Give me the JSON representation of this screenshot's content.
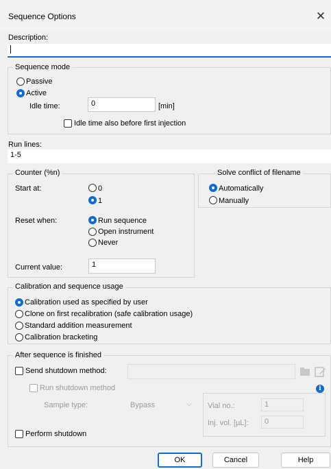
{
  "window": {
    "title": "Sequence Options"
  },
  "description": {
    "label": "Description:",
    "value": ""
  },
  "sequence_mode": {
    "legend": "Sequence mode",
    "options": [
      "Passive",
      "Active"
    ],
    "selected": "Active",
    "idle_time_label": "Idle time:",
    "idle_time_value": "0",
    "idle_time_unit": "[min]",
    "idle_before_first_label": "Idle time also before first injection",
    "idle_before_first_checked": false
  },
  "run_lines": {
    "label": "Run lines:",
    "value": "1-5"
  },
  "counter": {
    "legend": "Counter (%n)",
    "start_at_label": "Start at:",
    "start_options": [
      "0",
      "1"
    ],
    "start_selected": "1",
    "reset_when_label": "Reset when:",
    "reset_options": [
      "Run sequence",
      "Open instrument",
      "Never"
    ],
    "reset_selected": "Run sequence",
    "current_value_label": "Current value:",
    "current_value": "1"
  },
  "filename_conflict": {
    "legend": "Solve conflict of filename",
    "options": [
      "Automatically",
      "Manually"
    ],
    "selected": "Automatically"
  },
  "calibration": {
    "legend": "Calibration and sequence usage",
    "options": [
      "Calibration used as specified by user",
      "Clone on first recalibration (safe calibration usage)",
      "Standard addition measurement",
      "Calibration bracketing"
    ],
    "selected": "Calibration used as specified by user"
  },
  "after_sequence": {
    "legend": "After sequence is finished",
    "send_shutdown_label": "Send shutdown method:",
    "send_shutdown_checked": false,
    "shutdown_method_value": "",
    "run_shutdown_label": "Run shutdown method",
    "sample_type_label": "Sample type:",
    "sample_type_value": "Bypass",
    "vial_no_label": "Vial no.:",
    "vial_no_value": "1",
    "inj_vol_label": "Inj. vol. [µL]:",
    "inj_vol_value": "0",
    "perform_shutdown_label": "Perform shutdown",
    "perform_shutdown_checked": false,
    "info_icon": "info-icon",
    "folder_icon": "folder-icon",
    "edit_icon": "edit-icon"
  },
  "buttons": {
    "ok": "OK",
    "cancel": "Cancel",
    "help": "Help"
  },
  "colors": {
    "accent": "#0f6bd6",
    "background": "#f0f0f0"
  }
}
